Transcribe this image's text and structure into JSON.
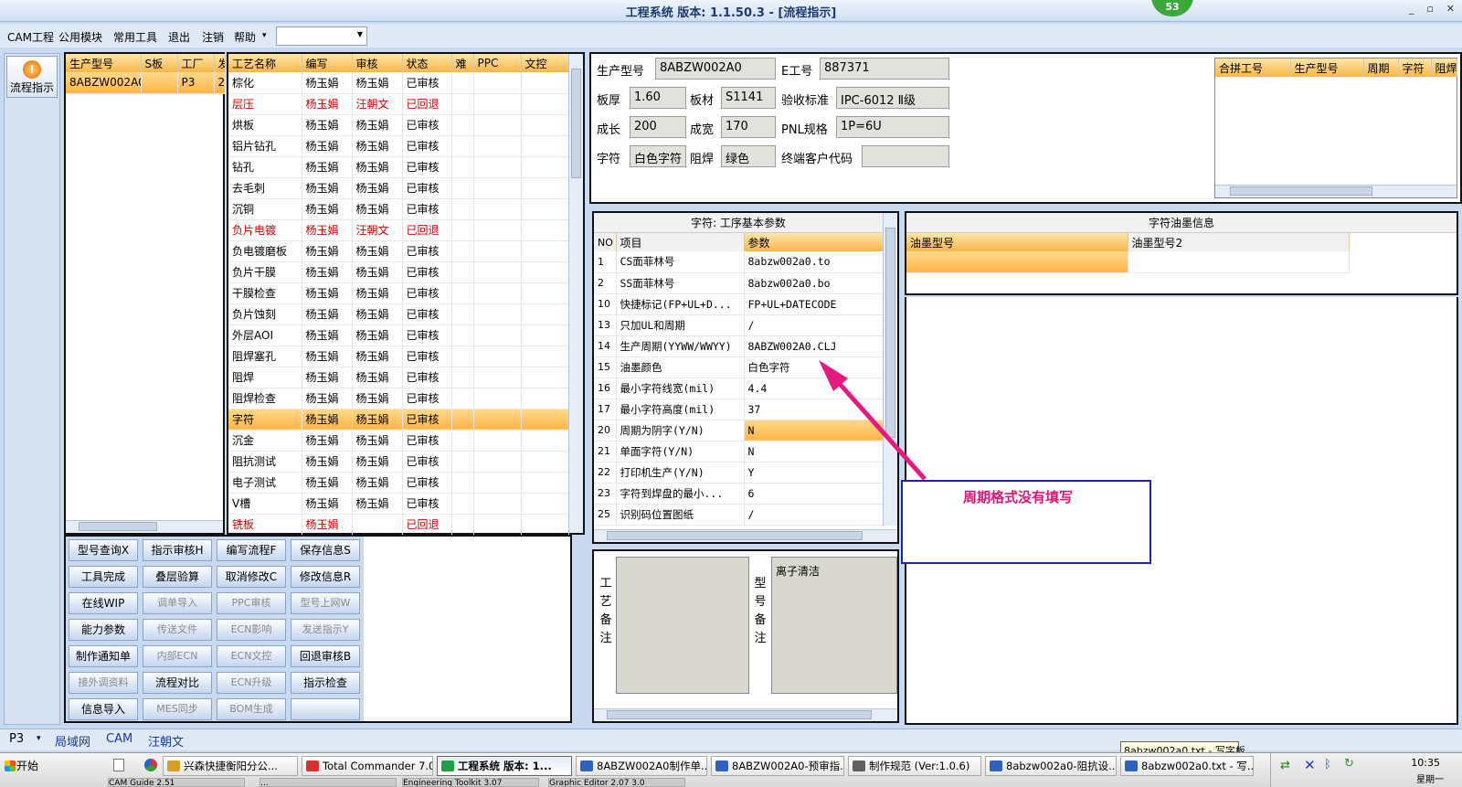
{
  "window": {
    "title": "工程系统  版本: 1.1.50.3 - [流程指示]",
    "badge": "53",
    "controls": [
      "_",
      "▫",
      "✕"
    ]
  },
  "menu": {
    "items": [
      "CAM工程",
      "公用模块",
      "常用工具",
      "退出",
      "注销",
      "帮助"
    ],
    "help_arrow": "▾",
    "combo_value": "",
    "mdi_controls": [
      "_",
      "▫",
      "✕"
    ]
  },
  "left_nav": {
    "flow_button_label": "流程指示"
  },
  "model_list": {
    "headers": [
      "生产型号",
      "S板",
      "工厂",
      "发"
    ],
    "rows": [
      [
        "8ABZW002A0",
        "",
        "P3",
        "2"
      ]
    ]
  },
  "process_table": {
    "headers": [
      "工艺名称",
      "编写",
      "审核",
      "状态",
      "难",
      "PPC",
      "文控"
    ],
    "rows": [
      {
        "cells": [
          "棕化",
          "杨玉娟",
          "杨玉娟",
          "已审核"
        ],
        "style": "normal"
      },
      {
        "cells": [
          "层压",
          "杨玉娟",
          "汪朝文",
          "已回退"
        ],
        "style": "red"
      },
      {
        "cells": [
          "烘板",
          "杨玉娟",
          "杨玉娟",
          "已审核"
        ],
        "style": "normal"
      },
      {
        "cells": [
          "铝片钻孔",
          "杨玉娟",
          "杨玉娟",
          "已审核"
        ],
        "style": "normal"
      },
      {
        "cells": [
          "钻孔",
          "杨玉娟",
          "杨玉娟",
          "已审核"
        ],
        "style": "normal"
      },
      {
        "cells": [
          "去毛刺",
          "杨玉娟",
          "杨玉娟",
          "已审核"
        ],
        "style": "normal"
      },
      {
        "cells": [
          "沉铜",
          "杨玉娟",
          "杨玉娟",
          "已审核"
        ],
        "style": "normal"
      },
      {
        "cells": [
          "负片电镀",
          "杨玉娟",
          "汪朝文",
          "已回退"
        ],
        "style": "red"
      },
      {
        "cells": [
          "负电镀磨板",
          "杨玉娟",
          "杨玉娟",
          "已审核"
        ],
        "style": "normal"
      },
      {
        "cells": [
          "负片干膜",
          "杨玉娟",
          "杨玉娟",
          "已审核"
        ],
        "style": "normal"
      },
      {
        "cells": [
          "干膜检查",
          "杨玉娟",
          "杨玉娟",
          "已审核"
        ],
        "style": "normal"
      },
      {
        "cells": [
          "负片蚀刻",
          "杨玉娟",
          "杨玉娟",
          "已审核"
        ],
        "style": "normal"
      },
      {
        "cells": [
          "外层AOI",
          "杨玉娟",
          "杨玉娟",
          "已审核"
        ],
        "style": "normal"
      },
      {
        "cells": [
          "阻焊塞孔",
          "杨玉娟",
          "杨玉娟",
          "已审核"
        ],
        "style": "normal"
      },
      {
        "cells": [
          "阻焊",
          "杨玉娟",
          "杨玉娟",
          "已审核"
        ],
        "style": "normal"
      },
      {
        "cells": [
          "阻焊检查",
          "杨玉娟",
          "杨玉娟",
          "已审核"
        ],
        "style": "normal"
      },
      {
        "cells": [
          "字符",
          "杨玉娟",
          "杨玉娟",
          "已审核"
        ],
        "style": "selected"
      },
      {
        "cells": [
          "沉金",
          "杨玉娟",
          "杨玉娟",
          "已审核"
        ],
        "style": "normal"
      },
      {
        "cells": [
          "阻抗测试",
          "杨玉娟",
          "杨玉娟",
          "已审核"
        ],
        "style": "normal"
      },
      {
        "cells": [
          "电子测试",
          "杨玉娟",
          "杨玉娟",
          "已审核"
        ],
        "style": "normal"
      },
      {
        "cells": [
          "V槽",
          "杨玉娟",
          "杨玉娟",
          "已审核"
        ],
        "style": "normal"
      },
      {
        "cells": [
          "铣板",
          "杨玉娟",
          "",
          "已回退"
        ],
        "style": "red"
      }
    ]
  },
  "action_buttons": [
    {
      "label": "型号查询X",
      "enabled": true
    },
    {
      "label": "指示审核H",
      "enabled": true
    },
    {
      "label": "编写流程F",
      "enabled": true
    },
    {
      "label": "保存信息S",
      "enabled": true
    },
    {
      "label": "工具完成",
      "enabled": true
    },
    {
      "label": "叠层验算",
      "enabled": true
    },
    {
      "label": "取消修改C",
      "enabled": true
    },
    {
      "label": "修改信息R",
      "enabled": true
    },
    {
      "label": "在线WIP",
      "enabled": true
    },
    {
      "label": "调单导入",
      "enabled": false
    },
    {
      "label": "PPC审核",
      "enabled": false
    },
    {
      "label": "型号上网W",
      "enabled": false
    },
    {
      "label": "能力参数",
      "enabled": true
    },
    {
      "label": "传送文件",
      "enabled": false
    },
    {
      "label": "ECN影响",
      "enabled": false
    },
    {
      "label": "发送指示Y",
      "enabled": false
    },
    {
      "label": "制作通知单",
      "enabled": true
    },
    {
      "label": "内部ECN",
      "enabled": false
    },
    {
      "label": "ECN文控",
      "enabled": false
    },
    {
      "label": "回退审核B",
      "enabled": true
    },
    {
      "label": "接外调资料",
      "enabled": false
    },
    {
      "label": "流程对比",
      "enabled": true
    },
    {
      "label": "ECN升级",
      "enabled": false
    },
    {
      "label": "指示检查",
      "enabled": true
    },
    {
      "label": "信息导入",
      "enabled": true
    },
    {
      "label": "MES同步",
      "enabled": false
    },
    {
      "label": "BOM生成",
      "enabled": false
    },
    {
      "label": "",
      "enabled": true
    }
  ],
  "info": {
    "model_label": "生产型号",
    "model_value": "8ABZW002A0",
    "e_label": "E工号",
    "e_value": "887371",
    "thickness_label": "板厚",
    "thickness_value": "1.60",
    "material_label": "板材",
    "material_value": "S1141",
    "standard_label": "验收标准",
    "standard_value": "IPC-6012 Ⅱ级",
    "length_label": "成长",
    "length_value": "200",
    "width_label": "成宽",
    "width_value": "170",
    "pnl_label": "PNL规格",
    "pnl_value": "1P=6U",
    "char_label": "字符",
    "char_value": "白色字符",
    "mask_label": "阻焊",
    "mask_value": "绿色",
    "customer_label": "终端客户代码",
    "customer_value": ""
  },
  "merge_table": {
    "headers": [
      "合拼工号",
      "生产型号",
      "周期",
      "字符",
      "阻焊"
    ]
  },
  "params": {
    "caption": "字符: 工序基本参数",
    "headers": [
      "NO",
      "项目",
      "参数"
    ],
    "rows": [
      [
        "1",
        "CS面菲林号",
        "8abzw002a0.to"
      ],
      [
        "2",
        "SS面菲林号",
        "8abzw002a0.bo"
      ],
      [
        "10",
        "快捷标记(FP+UL+D...",
        "FP+UL+DATECODE"
      ],
      [
        "13",
        "只加UL和周期",
        "/"
      ],
      [
        "14",
        "生产周期(YYWW/WWYY)",
        "8ABZW002A0.CLJ"
      ],
      [
        "15",
        "油墨颜色",
        "白色字符"
      ],
      [
        "16",
        "最小字符线宽(mil)",
        "4.4"
      ],
      [
        "17",
        "最小字符高度(mil)",
        "37"
      ],
      [
        "20",
        "周期为阴字(Y/N)",
        "N"
      ],
      [
        "21",
        "单面字符(Y/N)",
        "N"
      ],
      [
        "22",
        "打印机生产(Y/N)",
        "Y"
      ],
      [
        "23",
        "字符到焊盘的最小...",
        "6"
      ],
      [
        "25",
        "识别码位置图纸",
        "/"
      ]
    ],
    "selected_row": 8
  },
  "ink": {
    "caption": "字符油墨信息",
    "headers": [
      "油墨型号",
      "油墨型号2"
    ]
  },
  "remarks": {
    "process_label": "工艺备注",
    "process_text": "",
    "model_label": "型号备注",
    "model_text": "离子清洁"
  },
  "annotation": {
    "text": "周期格式没有填写",
    "color": "#e0157a"
  },
  "statusbar": {
    "plant": "P3",
    "plant_arrow": "▾",
    "items": [
      "局域网",
      "CAM",
      "汪朝文"
    ]
  },
  "tooltip": "8abzw002a0.txt - 写字板",
  "taskbar": {
    "start": "开始",
    "tasks": [
      {
        "label": "兴森快捷衡阳分公...",
        "icon_color": "#d8a020"
      },
      {
        "label": "Total Commander 7.0 ...",
        "icon_color": "#d83030"
      },
      {
        "label": "工程系统  版本: 1...",
        "icon_color": "#20a040"
      },
      {
        "label": "8ABZW002A0制作单...",
        "icon_color": "#3060c0"
      },
      {
        "label": "8ABZW002A0-预审指...",
        "icon_color": "#3060c0"
      },
      {
        "label": "制作规范 (Ver:1.0.6)",
        "icon_color": "#606060"
      },
      {
        "label": "8abzw002a0-阻抗设...",
        "icon_color": "#3060c0"
      },
      {
        "label": "8abzw002a0.txt - 写...",
        "icon_color": "#3060c0"
      }
    ],
    "row2_items": [
      "CAM Guide 2.51",
      "...",
      "Engineering Toolkit 3.07",
      "Graphic Editor 2.07 3.0"
    ],
    "clock": "10:35",
    "day": "星期一"
  },
  "colors": {
    "accent": "#f7b64a",
    "red_text": "#d00000",
    "callout_border": "#2020c0"
  }
}
